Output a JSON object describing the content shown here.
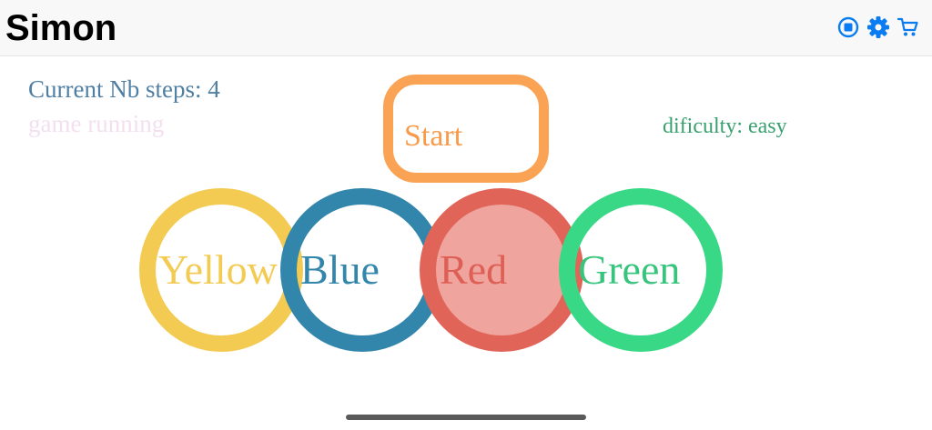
{
  "nav": {
    "title": "Simon",
    "icons": [
      "stop-circle-icon",
      "gear-icon",
      "cart-icon"
    ]
  },
  "game": {
    "steps_text": "Current Nb steps: 4",
    "status_text": "game running",
    "start_label": "Start",
    "difficulty_text": "dificulty: easy"
  },
  "buttons": [
    {
      "label": "Yellow",
      "ring": "#f3cb52",
      "fill": "transparent",
      "text": "#f3cb52"
    },
    {
      "label": "Blue",
      "ring": "#3286ab",
      "fill": "transparent",
      "text": "#3286ab"
    },
    {
      "label": "Red",
      "ring": "#e16459",
      "fill": "#efa49e",
      "text": "#dd5f55"
    },
    {
      "label": "Green",
      "ring": "#39d886",
      "fill": "transparent",
      "text": "#39c47d"
    }
  ],
  "colors": {
    "accent": "#0a7cf2",
    "start": "#fba355",
    "steps": "#4f7fa3",
    "status": "#f3e0ef",
    "difficulty": "#3aa06f"
  }
}
